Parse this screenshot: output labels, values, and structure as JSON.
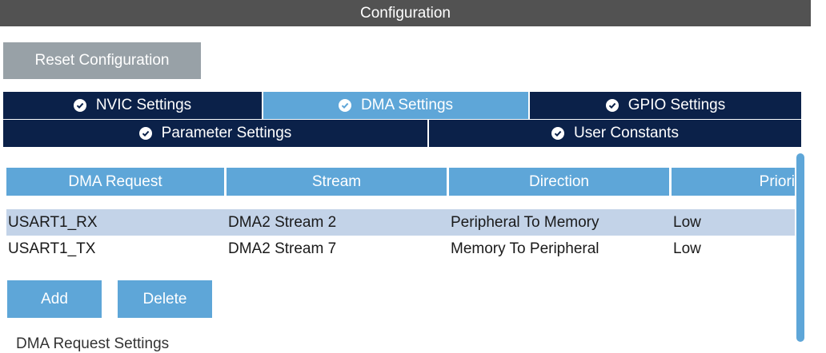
{
  "window": {
    "title": "Configuration"
  },
  "toolbar": {
    "reset_label": "Reset Configuration"
  },
  "tabs": {
    "row1": [
      {
        "label": "NVIC Settings",
        "active": false
      },
      {
        "label": "DMA Settings",
        "active": true
      },
      {
        "label": "GPIO Settings",
        "active": false
      }
    ],
    "row2": [
      {
        "label": "Parameter Settings",
        "active": false
      },
      {
        "label": "User Constants",
        "active": false
      }
    ]
  },
  "dma_table": {
    "headers": [
      "DMA Request",
      "Stream",
      "Direction",
      "Priori"
    ],
    "rows": [
      {
        "request": "USART1_RX",
        "stream": "DMA2 Stream 2",
        "direction": "Peripheral To Memory",
        "priority": "Low",
        "selected": true
      },
      {
        "request": "USART1_TX",
        "stream": "DMA2 Stream 7",
        "direction": "Memory To Peripheral",
        "priority": "Low",
        "selected": false
      }
    ]
  },
  "actions": {
    "add_label": "Add",
    "delete_label": "Delete"
  },
  "section": {
    "label": "DMA Request Settings"
  },
  "colors": {
    "accent": "#5ea6d8",
    "navy": "#0b2149",
    "titlebar": "#525252",
    "selected_row": "#c3d3e8",
    "button_gray": "#98a1a7"
  },
  "icons": {
    "tab_status": "check-circle-icon"
  }
}
